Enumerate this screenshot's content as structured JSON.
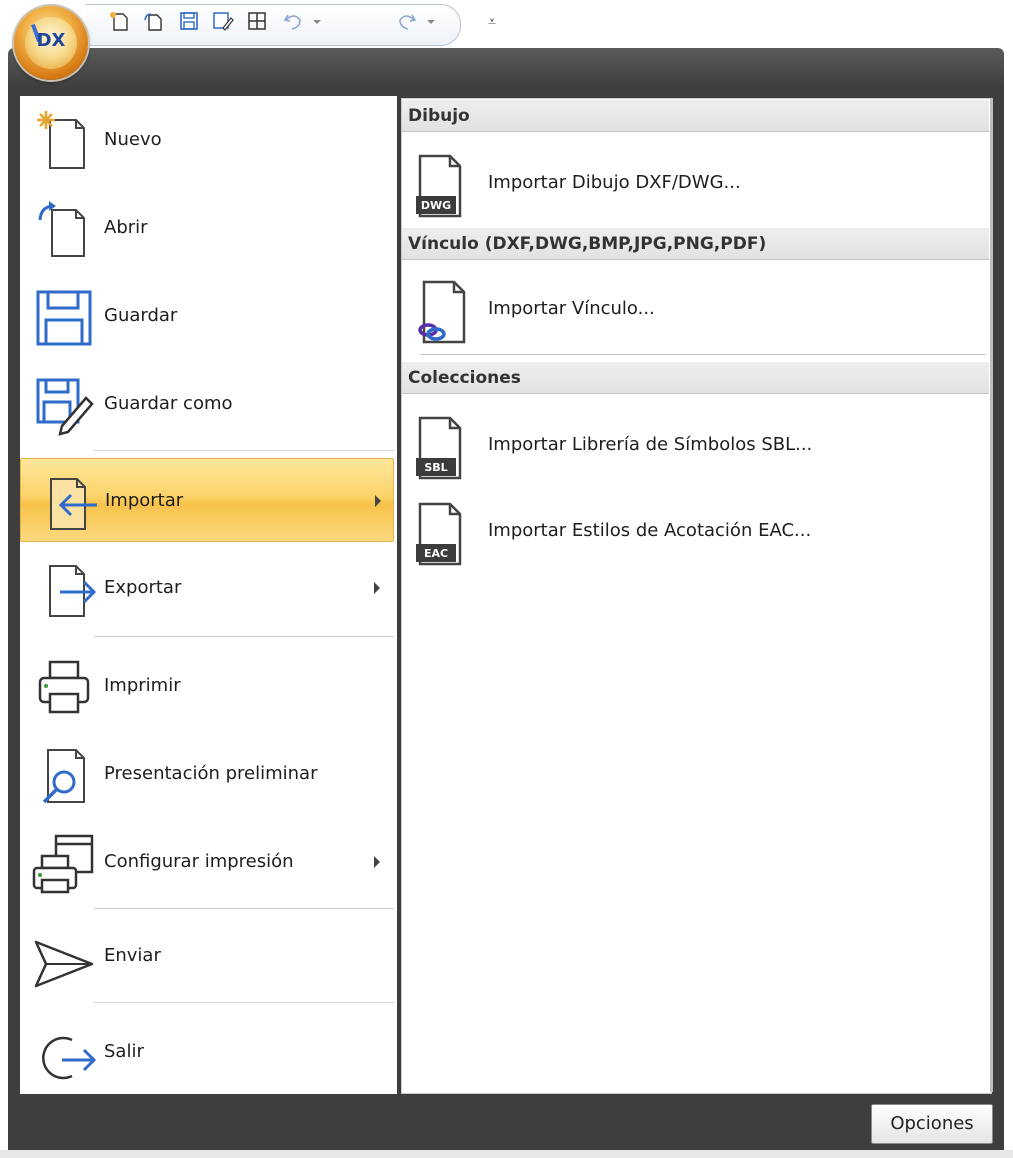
{
  "app_button": {
    "logo_text": "DX"
  },
  "qat": {
    "icons": [
      "new-icon",
      "open-icon",
      "save-icon",
      "save-as-icon",
      "grid-icon",
      "undo-icon",
      "redo-icon"
    ],
    "more_glyph": "⩡"
  },
  "left_menu": {
    "items": [
      {
        "label": "Nuevo",
        "icon": "new-document-icon"
      },
      {
        "label": "Abrir",
        "icon": "open-document-icon"
      },
      {
        "label": "Guardar",
        "icon": "save-icon"
      },
      {
        "label": "Guardar como",
        "icon": "save-as-icon"
      },
      {
        "label": "Importar",
        "icon": "import-icon",
        "selected": true,
        "submenu": true
      },
      {
        "label": "Exportar",
        "icon": "export-icon",
        "submenu": true
      },
      {
        "label": "Imprimir",
        "icon": "printer-icon"
      },
      {
        "label": "Presentación preliminar",
        "icon": "print-preview-icon"
      },
      {
        "label": "Configurar impresión",
        "icon": "print-setup-icon",
        "submenu": true
      },
      {
        "label": "Enviar",
        "icon": "send-icon"
      },
      {
        "label": "Salir",
        "icon": "exit-icon"
      }
    ]
  },
  "right_panel": {
    "sections": [
      {
        "header": "Dibujo",
        "items": [
          {
            "label": "Importar Dibujo DXF/DWG...",
            "badge": "DWG"
          }
        ]
      },
      {
        "header": "Vínculo (DXF,DWG,BMP,JPG,PNG,PDF)",
        "items": [
          {
            "label": "Importar Vínculo..."
          }
        ]
      },
      {
        "header": "Colecciones",
        "items": [
          {
            "label": "Importar Librería de Símbolos SBL...",
            "badge": "SBL"
          },
          {
            "label": "Importar Estilos de Acotación EAC...",
            "badge": "EAC"
          }
        ]
      }
    ]
  },
  "footer": {
    "options_label": "Opciones"
  },
  "colors": {
    "accent": "#2f6bc9",
    "selected_bg": "#fcd46a",
    "frame": "#3e3e3e"
  }
}
